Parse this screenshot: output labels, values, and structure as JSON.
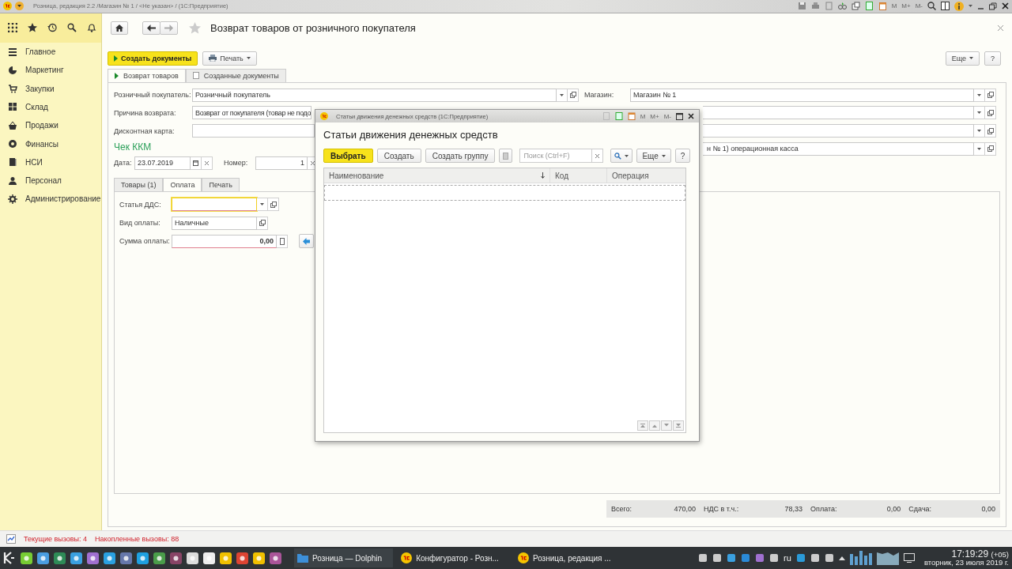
{
  "window": {
    "title": "Розница, редакция 2.2 /Магазин № 1 / <Не указан> /  (1С:Предприятие)",
    "calc_buttons": [
      "M",
      "M+",
      "M-"
    ]
  },
  "sidebar": {
    "items": [
      {
        "label": "Главное"
      },
      {
        "label": "Маркетинг"
      },
      {
        "label": "Закупки"
      },
      {
        "label": "Склад"
      },
      {
        "label": "Продажи"
      },
      {
        "label": "Финансы"
      },
      {
        "label": "НСИ"
      },
      {
        "label": "Персонал"
      },
      {
        "label": "Администрирование"
      }
    ]
  },
  "document": {
    "title": "Возврат товаров от розничного покупателя",
    "commands": [
      {
        "label": "Создать документы",
        "kind": "primary"
      },
      {
        "label": "Печать",
        "kind": "print"
      }
    ],
    "more": "Еще",
    "help": "?",
    "tabs": [
      {
        "label": "Возврат товаров",
        "selected": true
      },
      {
        "label": "Созданные документы",
        "selected": false
      }
    ],
    "left_fields": [
      {
        "label": "Розничный покупатель:",
        "value": "Розничный покупатель"
      },
      {
        "label": "Причина возврата:",
        "value": "Возврат от покупателя (товар не подо"
      },
      {
        "label": "Дисконтная карта:"
      }
    ],
    "right_fields": [
      {
        "kind": "field",
        "label": "Магазин:",
        "value": "Магазин № 1"
      },
      {
        "kind": "covered"
      },
      {
        "kind": "covered"
      },
      {
        "kind": "covered",
        "value": "н № 1) операционная касса"
      }
    ],
    "receipt": {
      "title": "Чек ККМ",
      "date_label": "Дата:",
      "date": "23.07.2019",
      "number_label": "Номер:",
      "number": "1"
    },
    "inner_tabs": [
      {
        "label": "Товары (1)",
        "selected": false
      },
      {
        "label": "Оплата",
        "selected": true
      },
      {
        "label": "Печать",
        "selected": false
      }
    ],
    "payment": [
      {
        "label": "Статья ДДС:",
        "kind": "select",
        "focused": true,
        "invalid": true
      },
      {
        "label": "Вид оплаты:",
        "kind": "open",
        "value": "Наличные",
        "focused": false,
        "invalid": false
      },
      {
        "label": "Сумма оплаты:",
        "kind": "amount",
        "value": "0,00",
        "focused": false,
        "invalid": true
      }
    ],
    "totals": [
      {
        "label": "Всего:",
        "value": "470,00"
      },
      {
        "label": "НДС в т.ч.:",
        "value": "78,33"
      },
      {
        "label": "Оплата:",
        "value": "0,00"
      },
      {
        "label": "Сдача:",
        "value": "0,00"
      }
    ]
  },
  "dialog": {
    "window_title": "Статьи движения денежных средств  (1С:Предприятие)",
    "calc_buttons": [
      "M",
      "M+",
      "M-"
    ],
    "title": "Статьи движения денежных средств",
    "buttons": [
      {
        "label": "Выбрать",
        "kind": "primary"
      },
      {
        "label": "Создать",
        "kind": "plain"
      },
      {
        "label": "Создать группу",
        "kind": "plain"
      }
    ],
    "search": {
      "placeholder": "Поиск (Ctrl+F)"
    },
    "more": "Еще",
    "help": "?",
    "columns": [
      {
        "label": "Наименование",
        "sorted": true
      },
      {
        "label": "Код",
        "sorted": false
      },
      {
        "label": "Операция",
        "sorted": false
      }
    ]
  },
  "status_bar": {
    "items": [
      "Текущие вызовы: 4",
      "Накопленные вызовы: 88"
    ]
  },
  "taskbar": {
    "tasks": [
      {
        "label": "Розница — Dolphin"
      },
      {
        "label": "Конфигуратор - Розн..."
      },
      {
        "label": "Розница, редакция ..."
      }
    ],
    "language": "ru",
    "time": "17:19:29",
    "timezone": "(+05)",
    "date": "вторник, 23 июля 2019 г."
  }
}
